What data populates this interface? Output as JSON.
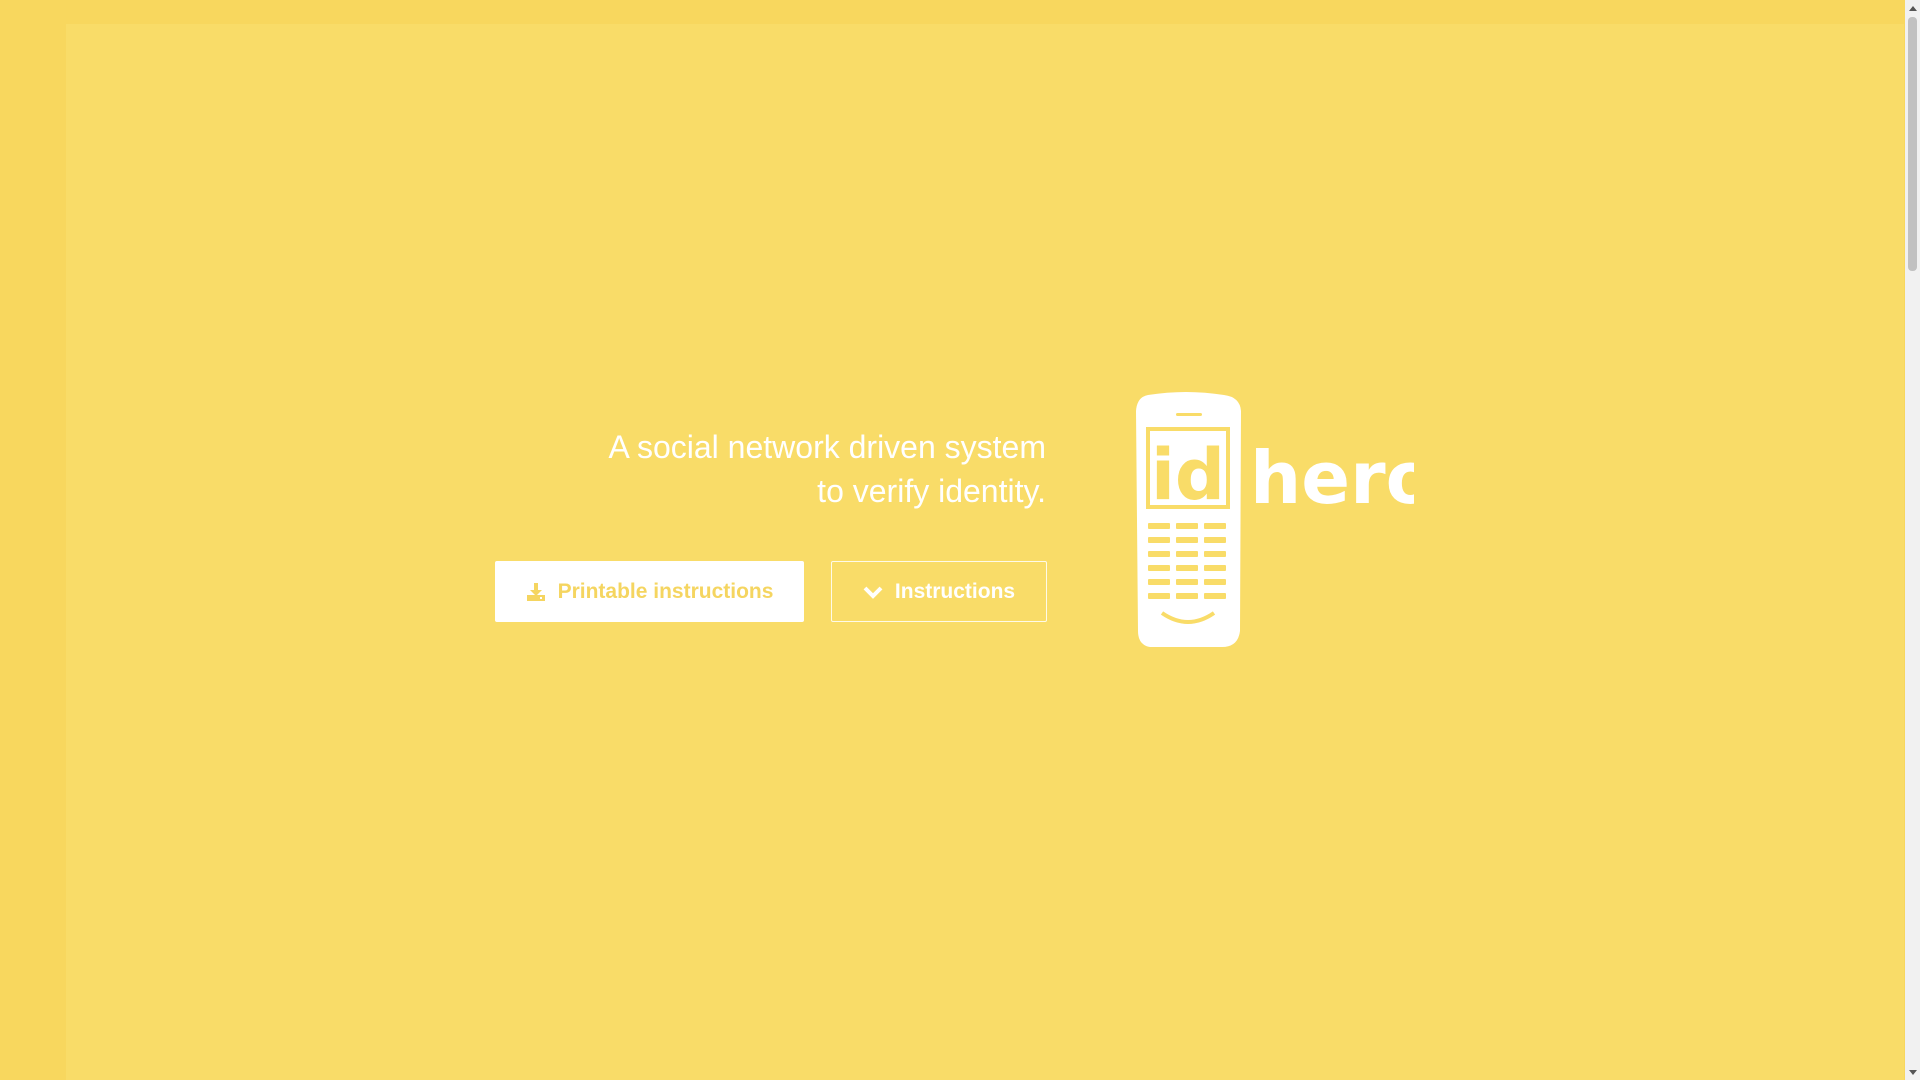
{
  "hero": {
    "tagline_line1": "A social network driven system",
    "tagline_line2": "to verify identity."
  },
  "buttons": {
    "printable_label": "Printable instructions",
    "printable_icon": "download-icon",
    "instructions_label": "Instructions",
    "instructions_icon": "chevron-down-icon"
  },
  "logo": {
    "id_text": "id",
    "name_text": "hero"
  },
  "colors": {
    "background": "#f8d75e",
    "panel": "#f9dc68",
    "primary_text": "#ffffff",
    "button_text": "#f5d560"
  }
}
